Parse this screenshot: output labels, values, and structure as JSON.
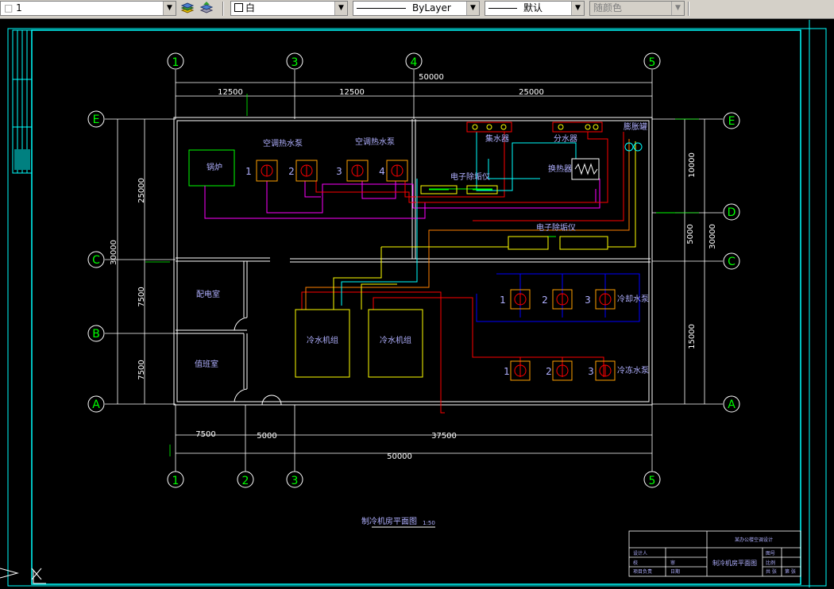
{
  "toolbar": {
    "layer_value": "1",
    "color_value": "白",
    "linetype_value": "ByLayer",
    "lineweight_value": "默认",
    "plotstyle_value": "随颜色"
  },
  "drawing": {
    "title": "制冷机房平面图",
    "scale": "1:50",
    "grid_top": [
      "1",
      "3",
      "4",
      "5"
    ],
    "grid_bottom": [
      "1",
      "2",
      "3",
      "5"
    ],
    "grid_left": [
      "E",
      "C",
      "B",
      "A"
    ],
    "grid_right": [
      "E",
      "D",
      "C",
      "A"
    ],
    "dims_top": {
      "total": "50000",
      "d1": "12500",
      "d2": "12500",
      "d3": "25000"
    },
    "dims_bottom": {
      "d1": "7500",
      "d2": "5000",
      "d3": "37500",
      "total": "50000"
    },
    "dims_left": {
      "top": "25000",
      "total": "30000",
      "mid": "7500",
      "low": "7500"
    },
    "dims_right": {
      "top": "10000",
      "mid": "5000",
      "total": "30000",
      "low": "15000"
    },
    "rooms": {
      "boiler": "锅炉",
      "power": "配电室",
      "duty": "值班室"
    },
    "ac_pumps": {
      "label1": "空调热水泵",
      "label2": "空调热水泵",
      "nums": [
        "1",
        "2",
        "3",
        "4"
      ]
    },
    "water_collector": "集水器",
    "water_distributor": "分水器",
    "expansion_tank": "膨胀罐",
    "descaler1": "电子除垢仪",
    "descaler2": "电子除垢仪",
    "heat_exchanger": "换热器",
    "chillers": [
      "冷水机组",
      "冷水机组"
    ],
    "cooling_pumps": {
      "label": "冷却水泵",
      "nums": [
        "1",
        "2",
        "3"
      ]
    },
    "chilled_pumps": {
      "label": "冷冻水泵",
      "nums": [
        "1",
        "2",
        "3"
      ]
    }
  },
  "title_block": {
    "project": "某办公楼空调设计",
    "drawing_name": "制冷机房平面图",
    "r1c1": "设计人",
    "r2c1": "校",
    "r2c2": "审",
    "r3c1": "项目负责",
    "r3c2": "日期",
    "r1c4": "图号",
    "r2c4": "比例",
    "r3c4": "共 张",
    "r3c5": "第 张"
  },
  "colors": {
    "frame": "#00ffff",
    "wall": "#ffffff",
    "grid_bubble": "#00ff00",
    "equipment_red": "#ff0000",
    "magenta_pipe": "#ff00ff",
    "blue_pipe": "#0000ff",
    "yellow_pipe": "#ffff00",
    "label": "#b0b0ff"
  }
}
